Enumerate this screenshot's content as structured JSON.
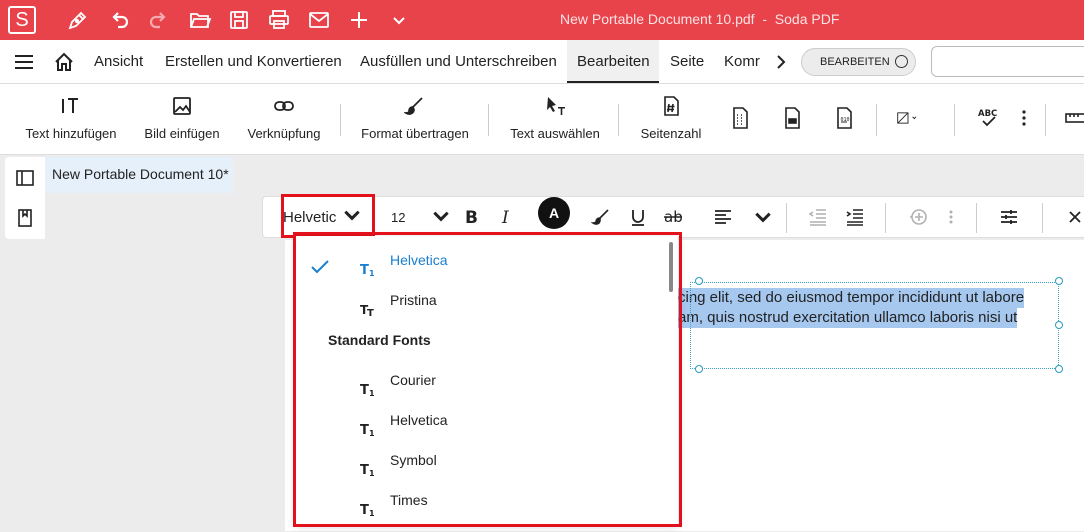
{
  "colors": {
    "brand": "#e8434b",
    "accent_blue": "#1a7fd0",
    "highlight": "#e3111b",
    "selection": "#a6c8ef"
  },
  "titlebar": {
    "logo": "S",
    "doc_name": "New Portable Document 10.pdf",
    "separator": "-",
    "app_name": "Soda PDF",
    "icons": [
      "pen-icon",
      "undo-icon",
      "redo-icon",
      "open-folder-icon",
      "save-icon",
      "print-icon",
      "mail-icon",
      "plus-icon",
      "chevron-down-icon"
    ]
  },
  "menubar": {
    "items": [
      "Ansicht",
      "Erstellen und Konvertieren",
      "Ausfüllen und Unterschreiben",
      "Bearbeiten",
      "Seite",
      "Komr"
    ],
    "active": "Bearbeiten",
    "edit_toggle_label": "BEARBEITEN"
  },
  "ribbon": {
    "items": [
      {
        "label": "Text hinzufügen",
        "icon": "add-text-icon"
      },
      {
        "label": "Bild einfügen",
        "icon": "image-icon"
      },
      {
        "label": "Verknüpfung",
        "icon": "link-icon"
      },
      {
        "label": "Format übertragen",
        "icon": "brush-icon"
      },
      {
        "label": "Text auswählen",
        "icon": "select-text-icon"
      },
      {
        "label": "Seitenzahl",
        "icon": "page-number-icon"
      }
    ]
  },
  "document": {
    "tab_title": "New Portable Document 10*",
    "selected_text_line1": "cing elit, sed do eiusmod tempor incididunt ut labore",
    "selected_text_line2": "am, quis nostrud exercitation ullamco laboris nisi ut"
  },
  "format_toolbar": {
    "font_value": "Helvetic",
    "size_value": "12",
    "color_label": "A"
  },
  "font_dropdown": {
    "recent": [
      {
        "label": "Helvetica",
        "selected": true
      },
      {
        "label": "Pristina",
        "selected": false
      }
    ],
    "section_heading": "Standard Fonts",
    "standard": [
      "Courier",
      "Helvetica",
      "Symbol",
      "Times"
    ]
  }
}
